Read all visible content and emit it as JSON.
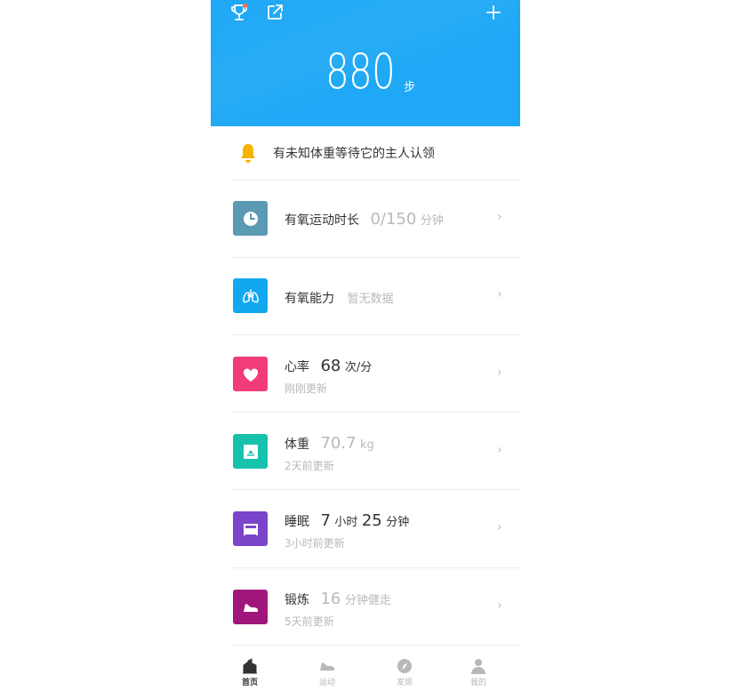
{
  "header": {
    "steps_value": "880",
    "steps_unit": "步",
    "background_color": "#1ea8f5",
    "icons": [
      "trophy-icon",
      "share-icon",
      "plus-icon"
    ]
  },
  "notice": {
    "text": "有未知体重等待它的主人认领",
    "icon": "bell-icon",
    "icon_color": "#f5b400"
  },
  "rows": [
    {
      "title": "有氧运动时长",
      "value": "0/150",
      "unit": "分钟",
      "icon": "clock-icon",
      "color": "#5b9ab3"
    },
    {
      "title": "有氧能力",
      "value_text": "暂无数据",
      "icon": "lungs-icon",
      "color": "#12a8f0"
    },
    {
      "title": "心率",
      "value": "68",
      "unit": "次/分",
      "subtitle": "刚刚更新",
      "icon": "heart-icon",
      "color": "#f23c78"
    },
    {
      "title": "体重",
      "value": "70.7",
      "unit": "kg",
      "subtitle": "2天前更新",
      "icon": "scale-icon",
      "color": "#17c2ac"
    },
    {
      "title": "睡眠",
      "value1": "7",
      "unit1": "小时",
      "value2": "25",
      "unit2": "分钟",
      "subtitle": "3小时前更新",
      "icon": "bed-icon",
      "color": "#7b45c9"
    },
    {
      "title": "锻炼",
      "value": "16",
      "unit": "分钟健走",
      "subtitle": "5天前更新",
      "icon": "shoe-icon",
      "color": "#a0167a"
    }
  ],
  "chevron": "›",
  "bottom_nav": [
    {
      "label": "首页",
      "icon": "home-chart-icon",
      "active": true
    },
    {
      "label": "运动",
      "icon": "shoe-icon",
      "active": false
    },
    {
      "label": "发现",
      "icon": "compass-icon",
      "active": false
    },
    {
      "label": "我的",
      "icon": "person-icon",
      "active": false
    }
  ]
}
